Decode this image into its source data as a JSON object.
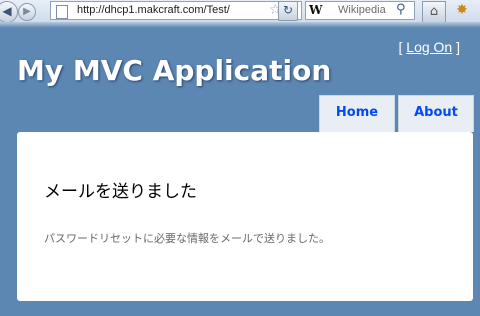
{
  "browser": {
    "back_icon": "back-arrow-icon",
    "forward_icon": "forward-arrow-icon",
    "url": "http://dhcp1.makcraft.com/Test/",
    "reload_icon": "reload-icon",
    "search_engine": "W",
    "search_placeholder": "Wikipedia",
    "home_icon": "home-icon",
    "addon_icon": "addon-icon"
  },
  "header": {
    "login_open": "[ ",
    "login_link": "Log On",
    "login_close": " ]",
    "title": "My MVC Application"
  },
  "menu": {
    "items": [
      {
        "label": "Home"
      },
      {
        "label": "About"
      }
    ]
  },
  "main": {
    "heading": "メールを送りました",
    "message": "パスワードリセットに必要な情報をメールで送りました。"
  },
  "colors": {
    "page_background": "#5c87b2",
    "menu_link": "#034af3",
    "content_background": "#ffffff"
  }
}
